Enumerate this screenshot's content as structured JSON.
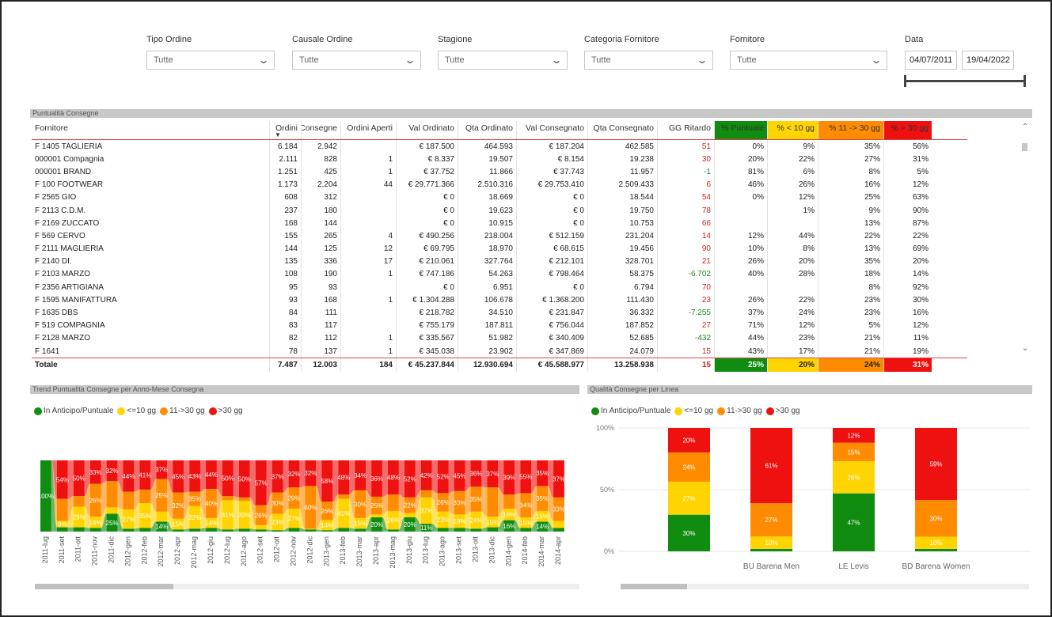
{
  "filters": [
    {
      "label": "Tipo Ordine",
      "value": "Tutte"
    },
    {
      "label": "Causale Ordine",
      "value": "Tutte"
    },
    {
      "label": "Stagione",
      "value": "Tutte"
    },
    {
      "label": "Categoria Fornitore",
      "value": "Tutte"
    },
    {
      "label": "Fornitore",
      "value": "Tutte"
    }
  ],
  "date": {
    "label": "Data",
    "from": "04/07/2011",
    "to": "19/04/2022"
  },
  "table": {
    "title": "Puntualità Consegne",
    "columns": [
      "Fornitore",
      "Ordini",
      "Consegne",
      "Ordini Aperti",
      "Val Ordinato",
      "Qta Ordinato",
      "Val Consegnato",
      "Qta Consegnato",
      "GG Ritardo",
      "% Puntuale",
      "% < 10 gg",
      "% 11 -> 30 gg",
      "% > 30 gg"
    ],
    "rows": [
      [
        "F 1405 TAGLIERIA",
        "6.184",
        "2.942",
        "",
        "€ 187.500",
        "464.593",
        "€ 187.204",
        "462.585",
        "51",
        "0%",
        "9%",
        "35%",
        "56%"
      ],
      [
        "000001 Compagnia",
        "2.111",
        "828",
        "1",
        "€ 8.337",
        "19.507",
        "€ 8.154",
        "19.238",
        "30",
        "20%",
        "22%",
        "27%",
        "31%"
      ],
      [
        "000001 BRAND",
        "1.251",
        "425",
        "1",
        "€ 37.752",
        "11.866",
        "€ 37.743",
        "11.957",
        "-1",
        "81%",
        "6%",
        "8%",
        "5%"
      ],
      [
        "F 100  FOOTWEAR",
        "1.173",
        "2.204",
        "44",
        "€ 29.771.366",
        "2.510.316",
        "€ 29.753.410",
        "2.509.433",
        "6",
        "46%",
        "26%",
        "16%",
        "12%"
      ],
      [
        "F 2565 GIO",
        "608",
        "312",
        "",
        "€ 0",
        "18.669",
        "€ 0",
        "18.544",
        "54",
        "0%",
        "12%",
        "25%",
        "63%"
      ],
      [
        "F 2113 C.D.M.",
        "237",
        "180",
        "",
        "€ 0",
        "19.623",
        "€ 0",
        "19.750",
        "78",
        "",
        "1%",
        "9%",
        "90%"
      ],
      [
        "F 2169 ZUCCATO",
        "168",
        "144",
        "",
        "€ 0",
        "10.915",
        "€ 0",
        "10.753",
        "66",
        "",
        "",
        "13%",
        "87%"
      ],
      [
        "F 569 CERVO",
        "155",
        "265",
        "4",
        "€ 490.256",
        "218.004",
        "€ 512.159",
        "231.204",
        "14",
        "12%",
        "44%",
        "22%",
        "22%"
      ],
      [
        "F 2111 MAGLIERIA",
        "144",
        "125",
        "12",
        "€ 69.795",
        "18.970",
        "€ 68.615",
        "19.456",
        "90",
        "10%",
        "8%",
        "13%",
        "69%"
      ],
      [
        "F 2140 DI.",
        "135",
        "336",
        "17",
        "€ 210.061",
        "327.764",
        "€ 212.101",
        "328.701",
        "21",
        "26%",
        "20%",
        "35%",
        "20%"
      ],
      [
        "F 2103 MARZO",
        "108",
        "190",
        "1",
        "€ 747.186",
        "54.263",
        "€ 798.464",
        "58.375",
        "-6.702",
        "40%",
        "28%",
        "18%",
        "14%"
      ],
      [
        "F 2356 ARTIGIANA",
        "95",
        "93",
        "",
        "€ 0",
        "6.951",
        "€ 0",
        "6.794",
        "70",
        "",
        "",
        "8%",
        "92%"
      ],
      [
        "F 1595 MANIFATTURA",
        "93",
        "168",
        "1",
        "€ 1.304.288",
        "106.678",
        "€ 1.368.200",
        "111.430",
        "23",
        "26%",
        "22%",
        "23%",
        "30%"
      ],
      [
        "F 1635 DBS",
        "84",
        "111",
        "",
        "€ 218.782",
        "34.510",
        "€ 231.847",
        "36.332",
        "-7.255",
        "37%",
        "24%",
        "23%",
        "16%"
      ],
      [
        "F 519 COMPAGNIA",
        "83",
        "117",
        "",
        "€ 755.179",
        "187.811",
        "€ 756.044",
        "187.852",
        "27",
        "71%",
        "12%",
        "5%",
        "12%"
      ],
      [
        "F 2128 MARZO",
        "82",
        "112",
        "1",
        "€ 335.567",
        "51.982",
        "€ 340.409",
        "52.685",
        "-432",
        "44%",
        "23%",
        "21%",
        "11%"
      ],
      [
        "F 1641",
        "78",
        "137",
        "1",
        "€ 345.038",
        "23.902",
        "€ 347.869",
        "24.079",
        "15",
        "43%",
        "17%",
        "21%",
        "19%"
      ]
    ],
    "total": [
      "Totale",
      "7.487",
      "12.003",
      "184",
      "€ 45.237.844",
      "12.930.694",
      "€ 45.588.977",
      "13.258.938",
      "15",
      "25%",
      "20%",
      "24%",
      "31%"
    ]
  },
  "legend": [
    "In Anticipo/Puntuale",
    "<=10 gg",
    "11->30 gg",
    ">30 gg"
  ],
  "colors": {
    "green": "#108c10",
    "yellow": "#ffd400",
    "orange": "#ff8c00",
    "red": "#ef1010",
    "positive": "#1a8a1a",
    "negative": "#d62020"
  },
  "chart_data": [
    {
      "type": "area",
      "title": "Trend Puntualità Consegne per Anno-Mese Consegna",
      "stacked": "100%",
      "x": [
        "2011-lug",
        "2011-set",
        "2011-ott",
        "2011-nov",
        "2011-dic",
        "2012-gen",
        "2012-feb",
        "2012-mar",
        "2012-apr",
        "2012-mag",
        "2012-giu",
        "2012-lug",
        "2012-ago",
        "2012-set",
        "2012-ott",
        "2012-nov",
        "2012-dic",
        "2013-gen",
        "2013-feb",
        "2013-mar",
        "2013-apr",
        "2013-mag",
        "2013-giu",
        "2013-lug",
        "2013-ago",
        "2013-set",
        "2013-ott",
        "2013-dic",
        "2014-gen",
        "2014-feb",
        "2014-mar",
        "2014-apr"
      ],
      "series": [
        {
          "name": "In Anticipo/Puntuale",
          "values": [
            100,
            6,
            6,
            5,
            25,
            4,
            5,
            14,
            3,
            4,
            5,
            3,
            4,
            3,
            2,
            5,
            3,
            2,
            5,
            4,
            20,
            3,
            20,
            11,
            5,
            5,
            4,
            6,
            16,
            5,
            14,
            5
          ]
        },
        {
          "name": "<=10 gg",
          "values": [
            0,
            9,
            29,
            16,
            9,
            27,
            35,
            14,
            15,
            32,
            14,
            41,
            39,
            6,
            23,
            27,
            1,
            14,
            41,
            15,
            4,
            26,
            6,
            37,
            23,
            19,
            24,
            15,
            16,
            15,
            15,
            10
          ]
        },
        {
          "name": "11->30 gg",
          "values": [
            0,
            31,
            15,
            46,
            37,
            25,
            19,
            46,
            37,
            20,
            41,
            6,
            5,
            28,
            30,
            30,
            60,
            26,
            6,
            39,
            25,
            23,
            22,
            10,
            26,
            33,
            35,
            41,
            20,
            34,
            35,
            33
          ]
        },
        {
          "name": ">30 gg",
          "values": [
            0,
            54,
            50,
            33,
            29,
            44,
            41,
            26,
            45,
            44,
            40,
            50,
            52,
            63,
            45,
            38,
            36,
            58,
            48,
            42,
            51,
            48,
            52,
            42,
            46,
            43,
            37,
            38,
            48,
            46,
            36,
            52
          ]
        }
      ],
      "labels": [
        [
          "100%",
          "",
          "",
          ""
        ],
        [
          "",
          "9%",
          "",
          "54%"
        ],
        [
          "",
          "29%",
          "",
          "50%"
        ],
        [
          "",
          "16%",
          "26%",
          "33%"
        ],
        [
          "25%",
          "",
          "",
          "32%"
        ],
        [
          "",
          "27%",
          "",
          "44%"
        ],
        [
          "",
          "35%",
          "",
          "41%"
        ],
        [
          "14%",
          "",
          "25%",
          "37%"
        ],
        [
          "",
          "15%",
          "32%",
          "45%"
        ],
        [
          "",
          "32%",
          "35%",
          "43%"
        ],
        [
          "",
          "14%",
          "40%",
          "44%"
        ],
        [
          "",
          "41%",
          "",
          "50%"
        ],
        [
          "",
          "39%",
          "",
          "50%"
        ],
        [
          "",
          "",
          "26%",
          "57%"
        ],
        [
          "",
          "23%",
          "30%",
          "37%"
        ],
        [
          "",
          "27%",
          "29%",
          "32%"
        ],
        [
          "",
          "",
          "60%",
          "32%"
        ],
        [
          "",
          "14%",
          "26%",
          "58%"
        ],
        [
          "",
          "41%",
          "",
          "48%"
        ],
        [
          "",
          "15%",
          "30%",
          "34%"
        ],
        [
          "20%",
          "",
          "25%",
          "36%"
        ],
        [
          "",
          "26%",
          "",
          "48%"
        ],
        [
          "20%",
          "",
          "22%",
          "52%"
        ],
        [
          "11%",
          "37%",
          "",
          "42%"
        ],
        [
          "",
          "23%",
          "26%",
          "52%"
        ],
        [
          "",
          "19%",
          "33%",
          "45%"
        ],
        [
          "",
          "24%",
          "35%",
          "36%"
        ],
        [
          "",
          "15%",
          "",
          "37%"
        ],
        [
          "16%",
          "16%",
          "",
          "39%"
        ],
        [
          "",
          "15%",
          "34%",
          "55%"
        ],
        [
          "14%",
          "15%",
          "35%",
          "35%"
        ],
        [
          "",
          "",
          "33%",
          "37%"
        ]
      ]
    },
    {
      "type": "bar",
      "stacked": "100%",
      "title": "Qualità Consegne per Linea",
      "categories": [
        "",
        "BU Barena Men",
        "LE Levis",
        "BD Barena Women"
      ],
      "ylim": [
        0,
        100
      ],
      "yticks": [
        "0%",
        "50%",
        "100%"
      ],
      "series": [
        {
          "name": "In Anticipo/Puntuale",
          "values": [
            30,
            2,
            47,
            2
          ]
        },
        {
          "name": "<=10 gg",
          "values": [
            27,
            10,
            26,
            10
          ]
        },
        {
          "name": "11->30 gg",
          "values": [
            24,
            27,
            15,
            30
          ]
        },
        {
          "name": ">30 gg",
          "values": [
            20,
            61,
            12,
            59
          ]
        }
      ],
      "labels": [
        [
          "30%",
          "",
          "47%",
          ""
        ],
        [
          "27%",
          "10%",
          "26%",
          "10%"
        ],
        [
          "24%",
          "27%",
          "15%",
          "30%"
        ],
        [
          "20%",
          "61%",
          "12%",
          "59%"
        ]
      ]
    }
  ]
}
